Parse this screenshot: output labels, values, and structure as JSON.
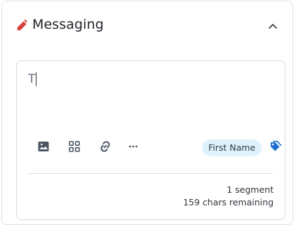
{
  "header": {
    "title": "Messaging",
    "icon": "pencil-icon",
    "icon_color": "#d7443f",
    "collapse_icon": "chevron-up-icon"
  },
  "editor": {
    "value": "T",
    "toolbar": {
      "icons": [
        "image-icon",
        "template-icon",
        "link-icon",
        "more-icon",
        "tag-icon"
      ],
      "chip_label": "First Name",
      "tag_icon_color": "#1f6fd1",
      "chip_bg": "#dff2fb"
    },
    "segment_text": "1 segment",
    "chars_text": "159 chars remaining"
  }
}
